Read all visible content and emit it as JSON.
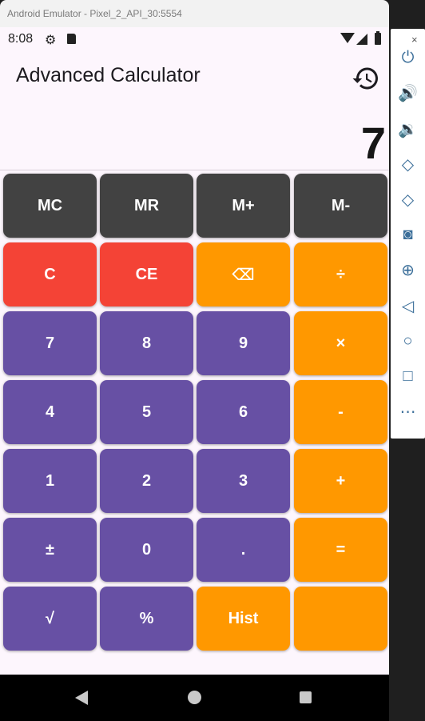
{
  "emulator": {
    "title": "Android Emulator - Pixel_2_API_30:5554",
    "side_tools": [
      "power-icon",
      "volume-up-icon",
      "volume-down-icon",
      "rotate-left-icon",
      "rotate-right-icon",
      "camera-icon",
      "zoom-icon",
      "back-icon",
      "home-icon",
      "overview-icon",
      "more-icon"
    ],
    "close_glyph": "×"
  },
  "status_bar": {
    "time": "8:08"
  },
  "app_bar": {
    "title": "Advanced Calculator"
  },
  "display": {
    "value": "7"
  },
  "keys": [
    {
      "label": "MC",
      "type": "mem"
    },
    {
      "label": "MR",
      "type": "mem"
    },
    {
      "label": "M+",
      "type": "mem"
    },
    {
      "label": "M-",
      "type": "mem"
    },
    {
      "label": "C",
      "type": "clear"
    },
    {
      "label": "CE",
      "type": "clear"
    },
    {
      "label": "⌫",
      "type": "op"
    },
    {
      "label": "÷",
      "type": "op"
    },
    {
      "label": "7",
      "type": "num"
    },
    {
      "label": "8",
      "type": "num"
    },
    {
      "label": "9",
      "type": "num"
    },
    {
      "label": "×",
      "type": "op"
    },
    {
      "label": "4",
      "type": "num"
    },
    {
      "label": "5",
      "type": "num"
    },
    {
      "label": "6",
      "type": "num"
    },
    {
      "label": "-",
      "type": "op"
    },
    {
      "label": "1",
      "type": "num"
    },
    {
      "label": "2",
      "type": "num"
    },
    {
      "label": "3",
      "type": "num"
    },
    {
      "label": "+",
      "type": "op"
    },
    {
      "label": "±",
      "type": "num"
    },
    {
      "label": "0",
      "type": "num"
    },
    {
      "label": ".",
      "type": "num"
    },
    {
      "label": "=",
      "type": "op"
    },
    {
      "label": "√",
      "type": "num"
    },
    {
      "label": "%",
      "type": "num"
    },
    {
      "label": "Hist",
      "type": "op"
    },
    {
      "label": "",
      "type": "op"
    }
  ],
  "colors": {
    "memory": "#424242",
    "clear": "#f44336",
    "operator": "#ff9800",
    "number": "#6750a4",
    "background": "#fdf6fd"
  }
}
